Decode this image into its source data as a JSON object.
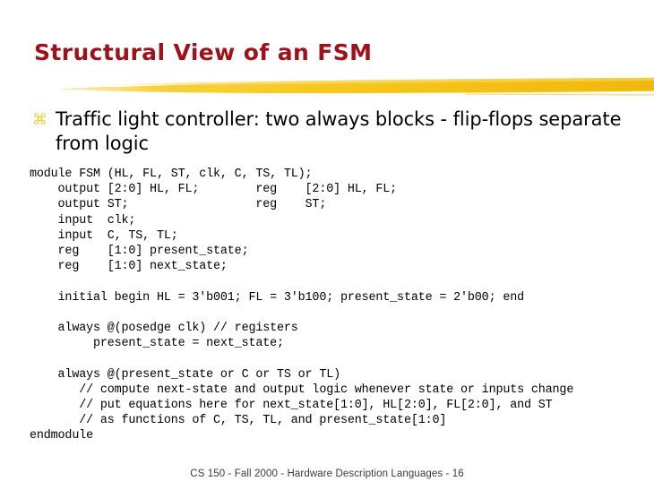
{
  "slide": {
    "title": "Structural View of an FSM",
    "title_color": "#A11119",
    "accent_color": "#F5C518",
    "background_color": "#FFFFFF"
  },
  "bullet": {
    "marker_icon": "wingdings-z-bullet-icon",
    "marker_glyph": "⌘",
    "marker_color": "#EFD040",
    "text": "Traffic light controller: two always blocks - flip-flops separate from logic"
  },
  "code": {
    "language": "verilog",
    "lines": [
      "module FSM (HL, FL, ST, clk, C, TS, TL);",
      "    output [2:0] HL, FL;        reg    [2:0] HL, FL;",
      "    output ST;                  reg    ST;",
      "    input  clk;",
      "    input  C, TS, TL;",
      "    reg    [1:0] present_state;",
      "    reg    [1:0] next_state;",
      "",
      "    initial begin HL = 3'b001; FL = 3'b100; present_state = 2'b00; end",
      "",
      "    always @(posedge clk) // registers",
      "         present_state = next_state;",
      "",
      "    always @(present_state or C or TS or TL)",
      "       // compute next-state and output logic whenever state or inputs change",
      "       // put equations here for next_state[1:0], HL[2:0], FL[2:0], and ST",
      "       // as functions of C, TS, TL, and present_state[1:0]",
      "endmodule"
    ]
  },
  "footer": {
    "text": "CS 150 - Fall 2000 - Hardware Description Languages - 16"
  }
}
